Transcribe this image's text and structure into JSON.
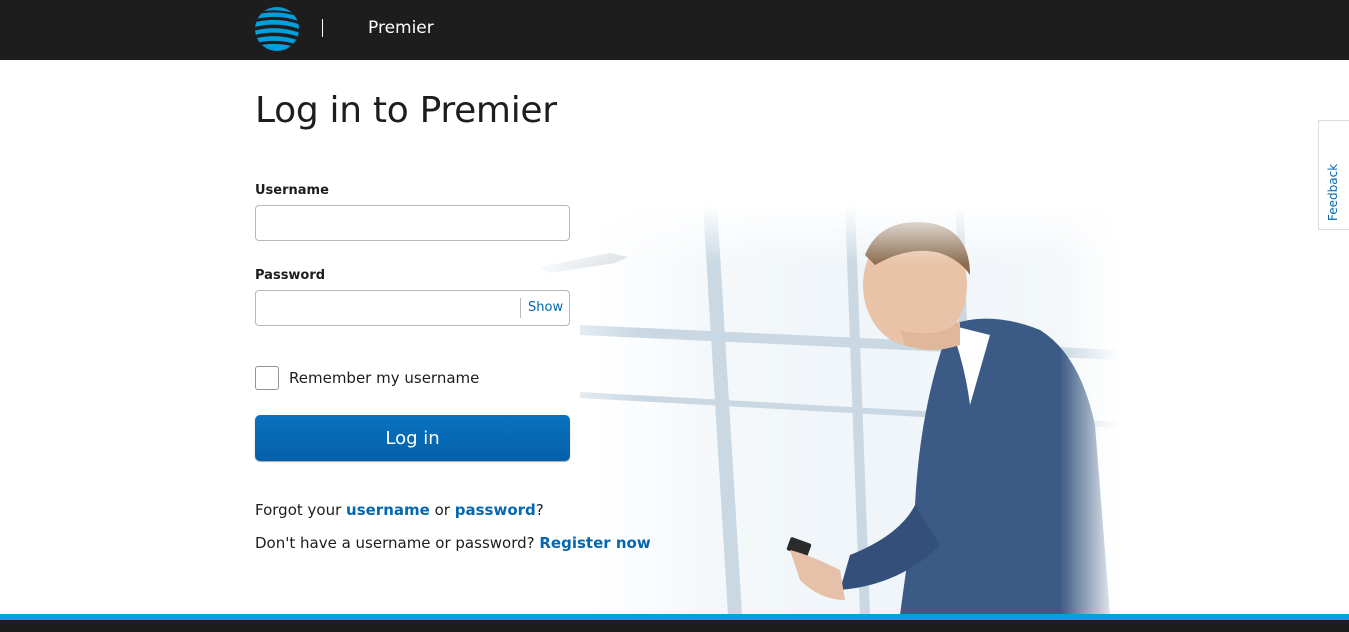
{
  "header": {
    "brand_name": "Premier",
    "logo_icon": "att-globe-icon"
  },
  "main": {
    "title": "Log in to Premier",
    "username": {
      "label": "Username",
      "value": "",
      "placeholder": ""
    },
    "password": {
      "label": "Password",
      "value": "",
      "placeholder": "",
      "show_label": "Show"
    },
    "remember": {
      "label": "Remember my username",
      "checked": false
    },
    "login_button": "Log in",
    "forgot": {
      "prefix": "Forgot your",
      "username_link": "username",
      "or": "or",
      "password_link": "password",
      "suffix": "?"
    },
    "register": {
      "prefix": "Don't have a username or password?",
      "link": "Register now"
    }
  },
  "feedback_tab": {
    "label": "Feedback"
  },
  "colors": {
    "topbar": "#1d1d1d",
    "accent_blue": "#0568ae",
    "button_blue": "#0a72c0",
    "footer_stripe": "#0b9ede"
  }
}
